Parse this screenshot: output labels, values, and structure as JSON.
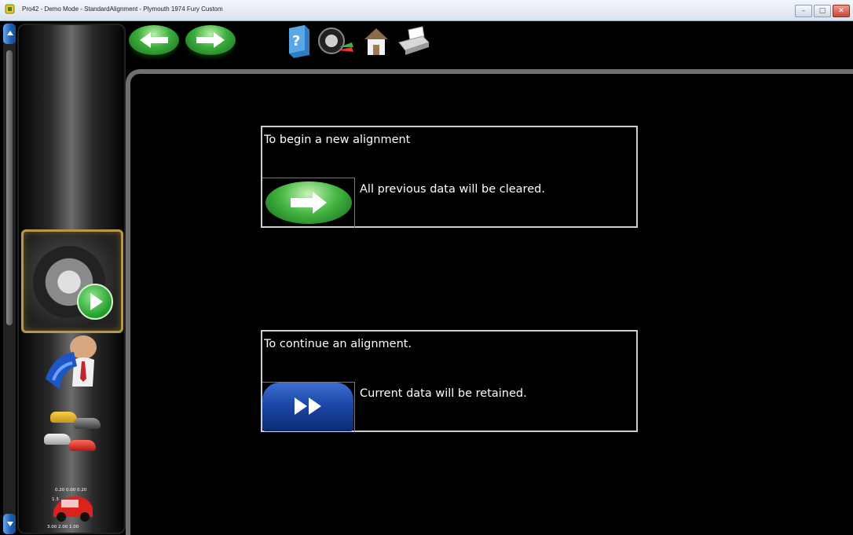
{
  "window": {
    "title": "Pro42 - Demo Mode - StandardAlignment - Plymouth 1974 Fury Custom",
    "controls": [
      "minimize",
      "maximize",
      "close"
    ]
  },
  "toolbar": {
    "nav": [
      {
        "name": "back",
        "icon": "arrow-left-icon"
      },
      {
        "name": "forward",
        "icon": "arrow-right-icon"
      }
    ],
    "tools": [
      {
        "name": "help",
        "icon": "help-book-icon"
      },
      {
        "name": "wheel-specs",
        "icon": "wheel-chart-icon"
      },
      {
        "name": "home",
        "icon": "home-icon"
      },
      {
        "name": "print",
        "icon": "printer-icon"
      }
    ]
  },
  "sidebar": {
    "items": [
      {
        "name": "start-alignment",
        "icon": "tire-play-icon",
        "selected": true
      },
      {
        "name": "customer",
        "icon": "customer-icon"
      },
      {
        "name": "vehicle-selection",
        "icon": "vehicles-icon"
      },
      {
        "name": "vehicle-specs",
        "icon": "vehicle-specs-icon",
        "overlay_text": [
          "0.20 0.00 0.20",
          "1.3",
          "3.00 2.00 1.00"
        ]
      }
    ]
  },
  "main": {
    "new_alignment": {
      "title": "To begin a new alignment",
      "message": "All previous data will be cleared.",
      "button_icon": "arrow-right-icon"
    },
    "continue_alignment": {
      "title": "To continue an alignment.",
      "message": "Current data will be retained.",
      "button_icon": "fast-forward-icon"
    }
  },
  "colors": {
    "accent_green": "#3cae3c",
    "accent_blue": "#1d48a8",
    "selected_border": "#b8974a",
    "background": "#000000"
  }
}
